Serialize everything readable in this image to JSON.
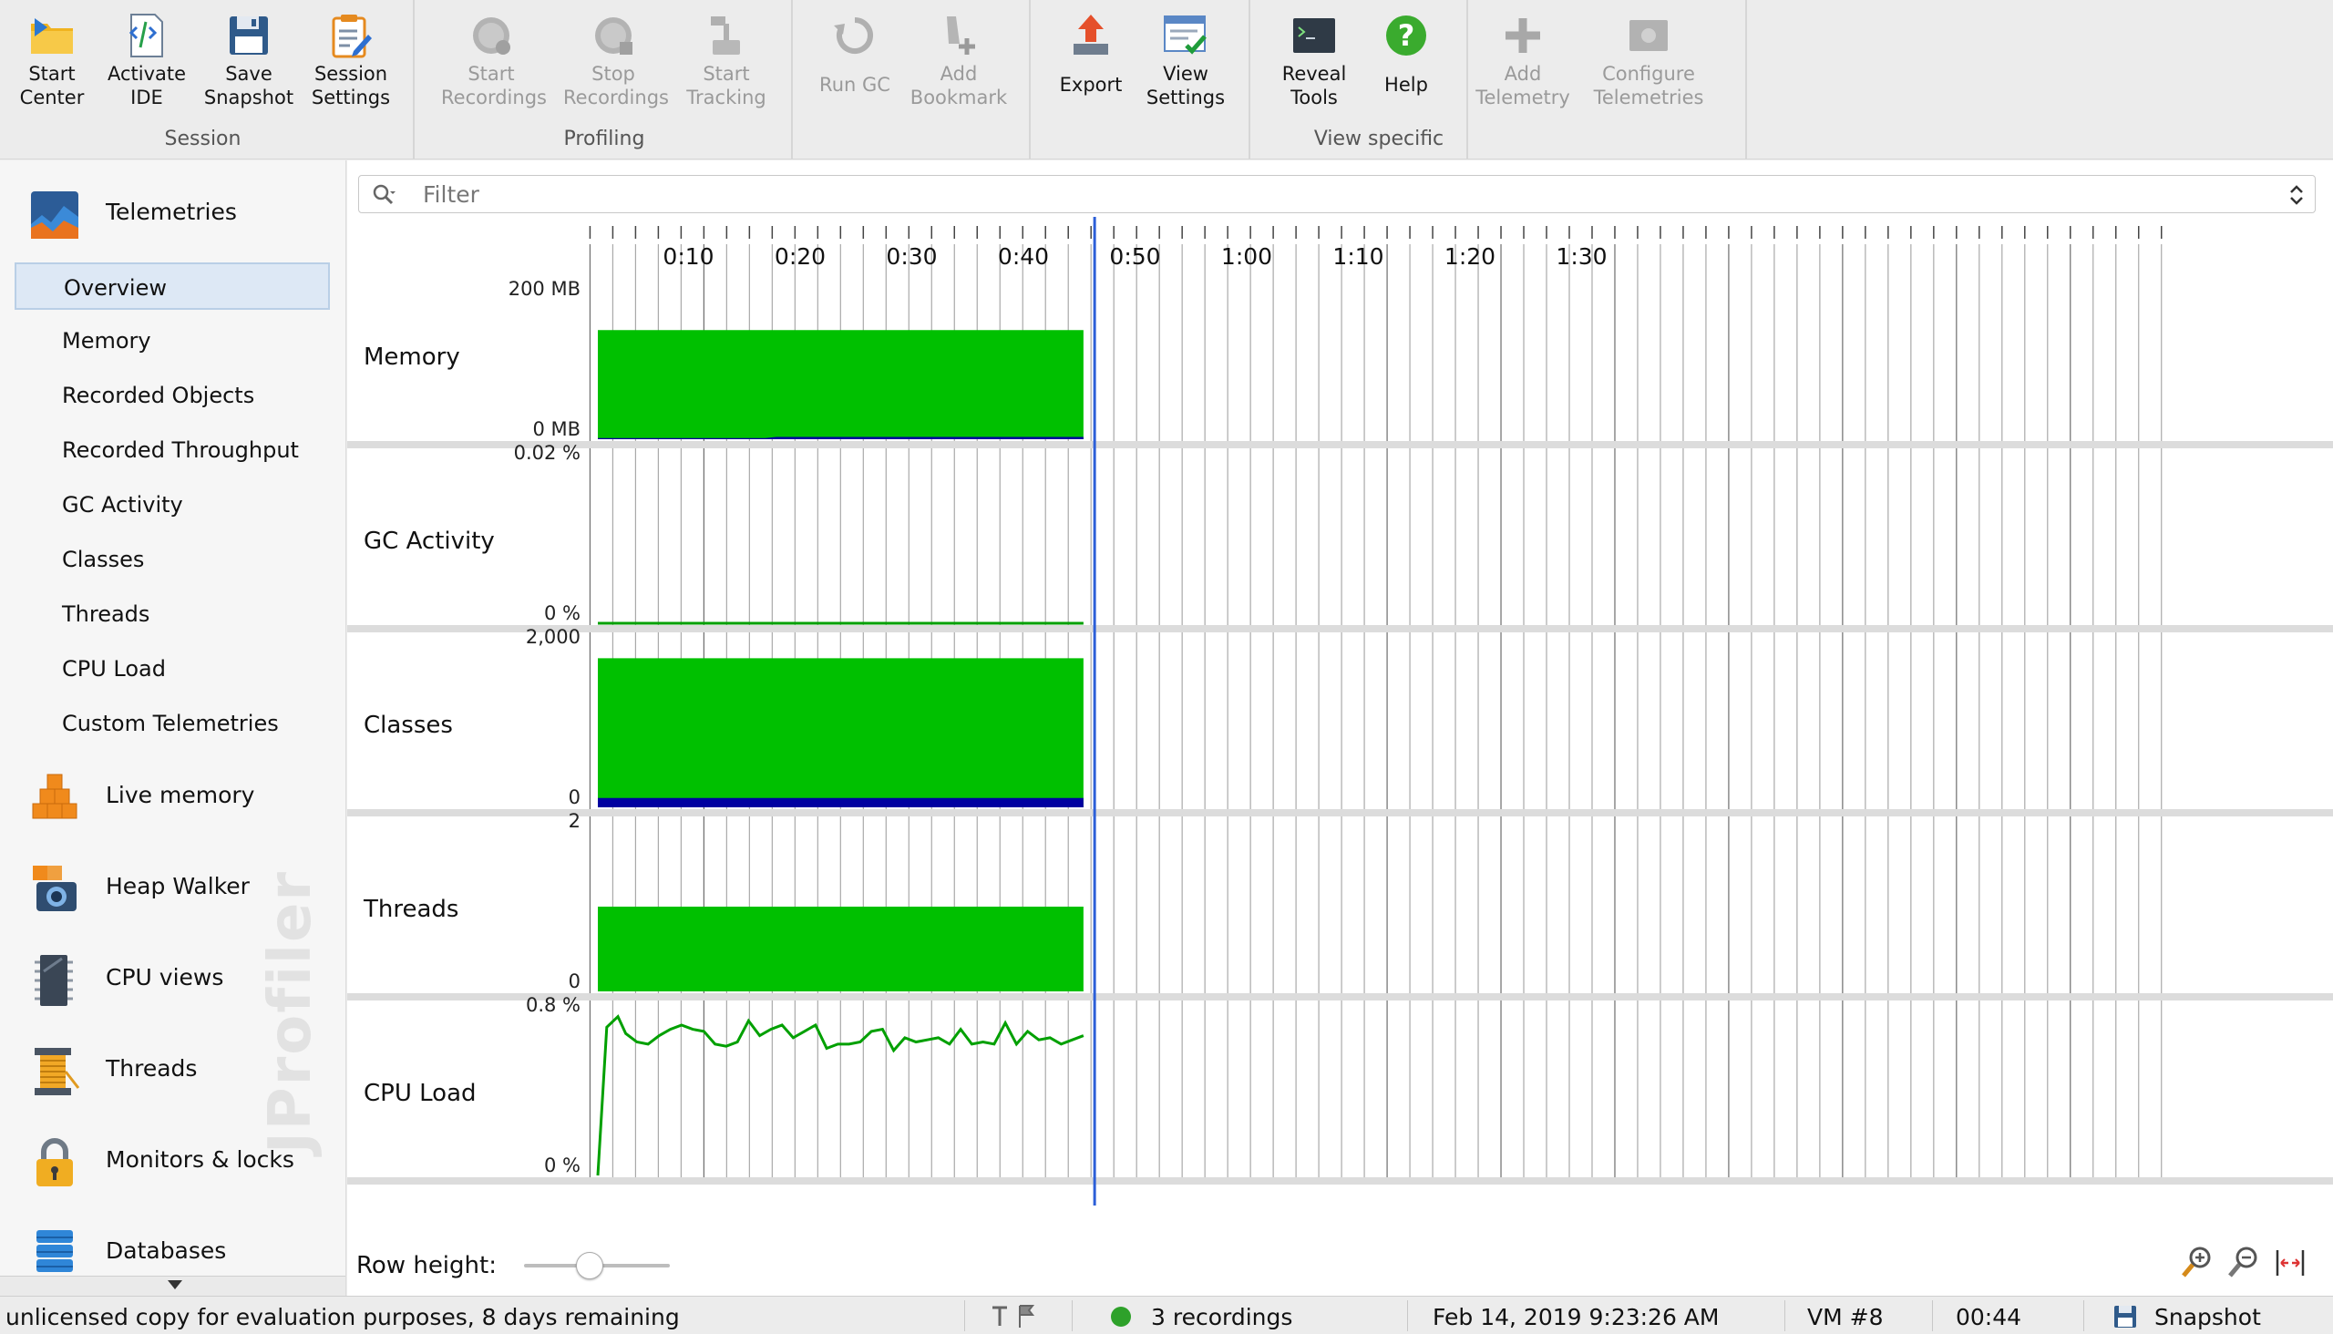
{
  "toolbar": {
    "groups": [
      {
        "label": "Session",
        "buttons": [
          {
            "label": "Start\nCenter",
            "icon": "start-center-icon",
            "enabled": true
          },
          {
            "label": "Activate\nIDE",
            "icon": "activate-ide-icon",
            "enabled": true
          },
          {
            "label": "Save\nSnapshot",
            "icon": "save-snapshot-icon",
            "enabled": true
          },
          {
            "label": "Session\nSettings",
            "icon": "session-settings-icon",
            "enabled": true
          }
        ]
      },
      {
        "label": "Profiling",
        "buttons": [
          {
            "label": "Start\nRecordings",
            "icon": "start-recordings-icon",
            "enabled": false
          },
          {
            "label": "Stop\nRecordings",
            "icon": "stop-recordings-icon",
            "enabled": false
          },
          {
            "label": "Start\nTracking",
            "icon": "start-tracking-icon",
            "enabled": false
          },
          {
            "label": "Run GC",
            "icon": "run-gc-icon",
            "enabled": false
          },
          {
            "label": "Add\nBookmark",
            "icon": "add-bookmark-icon",
            "enabled": false
          }
        ]
      },
      {
        "label": "View specific",
        "buttons": [
          {
            "label": "Export",
            "icon": "export-icon",
            "enabled": true
          },
          {
            "label": "View\nSettings",
            "icon": "view-settings-icon",
            "enabled": true
          },
          {
            "label": "Reveal\nTools",
            "icon": "reveal-tools-icon",
            "enabled": true
          },
          {
            "label": "Help",
            "icon": "help-icon",
            "enabled": true
          },
          {
            "label": "Add\nTelemetry",
            "icon": "add-telemetry-icon",
            "enabled": false
          },
          {
            "label": "Configure\nTelemetries",
            "icon": "configure-telemetries-icon",
            "enabled": false
          }
        ]
      }
    ]
  },
  "sidebar": {
    "sections": [
      {
        "label": "Telemetries",
        "icon": "telemetries-icon"
      },
      {
        "label": "Live memory",
        "icon": "live-memory-icon"
      },
      {
        "label": "Heap Walker",
        "icon": "heap-walker-icon"
      },
      {
        "label": "CPU views",
        "icon": "cpu-views-icon"
      },
      {
        "label": "Threads",
        "icon": "threads-section-icon"
      },
      {
        "label": "Monitors & locks",
        "icon": "monitors-locks-icon"
      },
      {
        "label": "Databases",
        "icon": "databases-icon"
      }
    ],
    "subitems": [
      "Overview",
      "Memory",
      "Recorded Objects",
      "Recorded Throughput",
      "GC Activity",
      "Classes",
      "Threads",
      "CPU Load",
      "Custom Telemetries"
    ],
    "selected_subitem": "Overview",
    "watermark": "JProfiler"
  },
  "filter": {
    "placeholder": "Filter",
    "icon": "search-icon"
  },
  "timeline": {
    "tick_labels": [
      "0:10",
      "0:20",
      "0:30",
      "0:40",
      "0:50",
      "1:00",
      "1:10",
      "1:20",
      "1:30"
    ],
    "current_time_seconds": 44.5,
    "data_end_seconds": 43.5
  },
  "chart_data": [
    {
      "type": "area",
      "name": "Memory",
      "ymax_label": "200 MB",
      "ymin_label": "0 MB",
      "ylim": [
        0,
        200
      ],
      "x": [
        0,
        15,
        16,
        43.5
      ],
      "series": [
        {
          "name": "",
          "color": "#00c000",
          "values": [
            146,
            146,
            146,
            146
          ]
        },
        {
          "name": "",
          "color": "#0000a0",
          "values": [
            1.5,
            1.5,
            3,
            3
          ]
        }
      ]
    },
    {
      "type": "line",
      "name": "GC Activity",
      "ymax_label": "0.02 %",
      "ymin_label": "0 %",
      "ylim": [
        0,
        0.02
      ],
      "x": [
        0,
        43.5
      ],
      "series": [
        {
          "name": "",
          "color": "#00a000",
          "values": [
            0,
            0
          ]
        }
      ]
    },
    {
      "type": "area",
      "name": "Classes",
      "ymax_label": "2,000",
      "ymin_label": "0",
      "ylim": [
        0,
        2000
      ],
      "x": [
        0,
        43.5
      ],
      "series": [
        {
          "name": "",
          "color": "#00c000",
          "values": [
            1760,
            1760
          ]
        },
        {
          "name": "",
          "color": "#0000a0",
          "values": [
            110,
            110
          ]
        }
      ]
    },
    {
      "type": "area",
      "name": "Threads",
      "ymax_label": "2",
      "ymin_label": "0",
      "ylim": [
        0,
        2
      ],
      "x": [
        0,
        43.5
      ],
      "series": [
        {
          "name": "",
          "color": "#00c000",
          "values": [
            1,
            1
          ]
        }
      ]
    },
    {
      "type": "line",
      "name": "CPU Load",
      "ymax_label": "0.8 %",
      "ymin_label": "0 %",
      "ylim": [
        0,
        0.8
      ],
      "x": [
        0,
        0.8,
        1.8,
        2.5,
        3.5,
        4.5,
        5.5,
        6.5,
        7.5,
        8.5,
        9.5,
        10.5,
        11.5,
        12.5,
        13.5,
        14.5,
        15.5,
        16.5,
        17.5,
        18.5,
        19.5,
        20.5,
        21.5,
        22.5,
        23.5,
        24.5,
        25.5,
        26.5,
        27.5,
        28.5,
        29.5,
        30.5,
        31.5,
        32.5,
        33.5,
        34.5,
        35.5,
        36.5,
        37.5,
        38.5,
        39.5,
        40.5,
        41.5,
        42.5,
        43.5
      ],
      "series": [
        {
          "name": "",
          "color": "#00a000",
          "values": [
            0,
            0.7,
            0.75,
            0.67,
            0.63,
            0.62,
            0.66,
            0.69,
            0.71,
            0.69,
            0.68,
            0.62,
            0.61,
            0.63,
            0.73,
            0.66,
            0.69,
            0.71,
            0.65,
            0.68,
            0.71,
            0.6,
            0.62,
            0.62,
            0.63,
            0.68,
            0.69,
            0.59,
            0.65,
            0.63,
            0.64,
            0.65,
            0.62,
            0.69,
            0.62,
            0.63,
            0.62,
            0.72,
            0.62,
            0.68,
            0.64,
            0.65,
            0.62,
            0.64,
            0.66
          ]
        }
      ]
    }
  ],
  "bottom": {
    "row_height_label": "Row height:",
    "row_height_fraction": 0.45
  },
  "statusbar": {
    "license_text": "unlicensed copy for evaluation purposes, 8 days remaining",
    "recordings": "3 recordings",
    "timestamp": "Feb 14, 2019 9:23:26 AM",
    "vm": "VM #8",
    "elapsed": "00:44",
    "snapshot": "Snapshot"
  }
}
